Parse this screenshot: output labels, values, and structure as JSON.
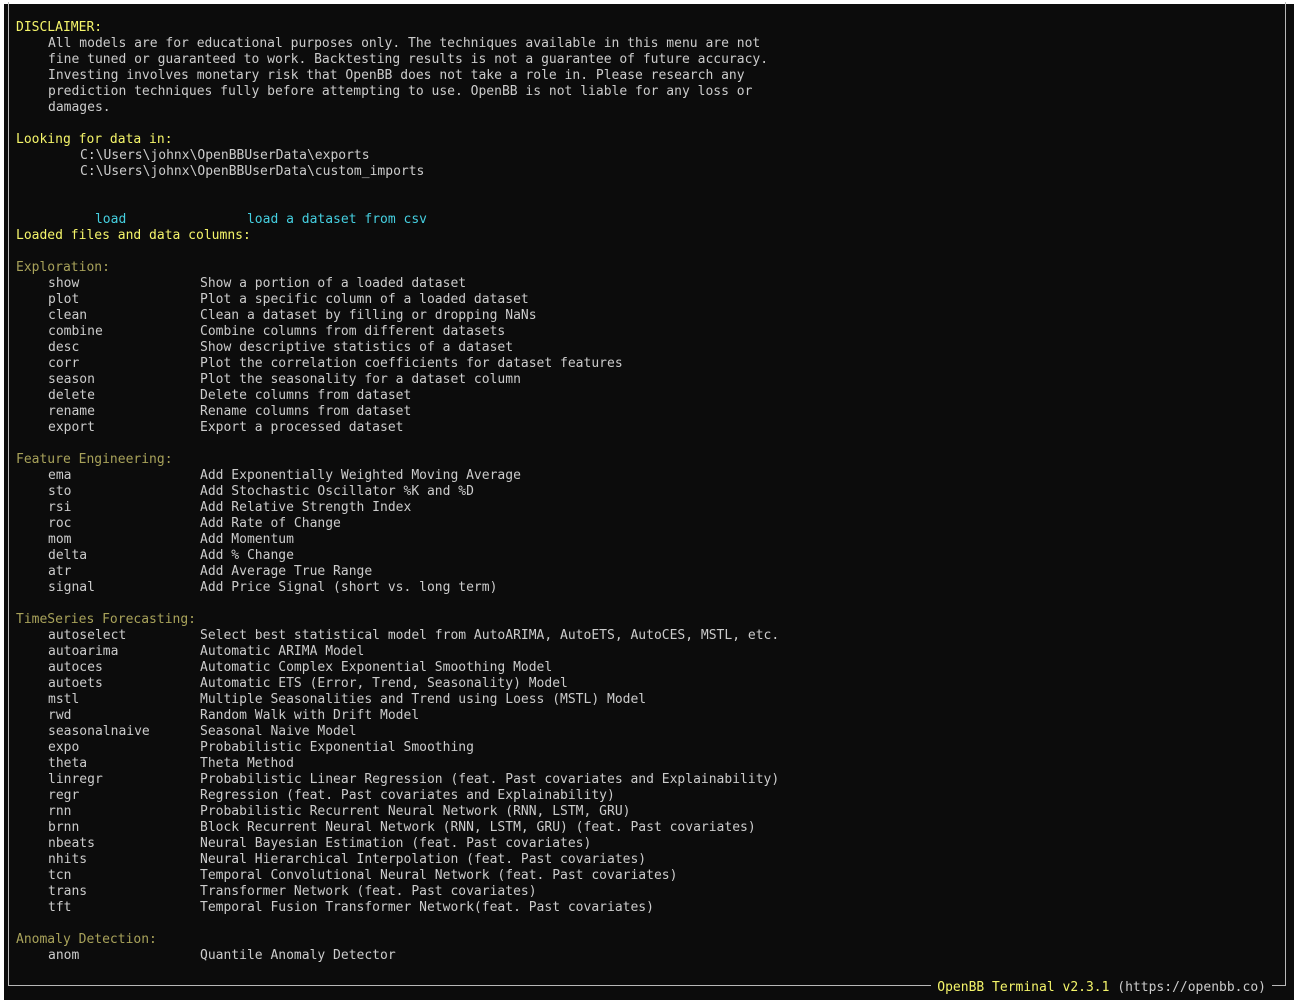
{
  "disclaimer": {
    "title": "DISCLAIMER:",
    "lines": [
      "All models are for educational purposes only. The techniques available in this menu are not",
      "fine tuned or guaranteed to work. Backtesting results is not a guarantee of future accuracy.",
      "Investing involves monetary risk that OpenBB does not take a role in. Please research any",
      "prediction techniques fully before attempting to use. OpenBB is not liable for any loss or",
      "damages."
    ]
  },
  "data_paths": {
    "title": "Looking for data in:",
    "paths": [
      "C:\\Users\\johnx\\OpenBBUserData\\exports",
      "C:\\Users\\johnx\\OpenBBUserData\\custom_imports"
    ]
  },
  "load": {
    "cmd": "load",
    "desc": "load a dataset from csv"
  },
  "loaded_title": "Loaded files and data columns:",
  "sections": [
    {
      "title": "Exploration:",
      "commands": [
        {
          "cmd": "show",
          "desc": "Show a portion of a loaded dataset"
        },
        {
          "cmd": "plot",
          "desc": "Plot a specific column of a loaded dataset"
        },
        {
          "cmd": "clean",
          "desc": "Clean a dataset by filling or dropping NaNs"
        },
        {
          "cmd": "combine",
          "desc": "Combine columns from different datasets"
        },
        {
          "cmd": "desc",
          "desc": "Show descriptive statistics of a dataset"
        },
        {
          "cmd": "corr",
          "desc": "Plot the correlation coefficients for dataset features"
        },
        {
          "cmd": "season",
          "desc": "Plot the seasonality for a dataset column"
        },
        {
          "cmd": "delete",
          "desc": "Delete columns from dataset"
        },
        {
          "cmd": "rename",
          "desc": "Rename columns from dataset"
        },
        {
          "cmd": "export",
          "desc": "Export a processed dataset"
        }
      ]
    },
    {
      "title": "Feature Engineering:",
      "commands": [
        {
          "cmd": "ema",
          "desc": "Add Exponentially Weighted Moving Average"
        },
        {
          "cmd": "sto",
          "desc": "Add Stochastic Oscillator %K and %D"
        },
        {
          "cmd": "rsi",
          "desc": "Add Relative Strength Index"
        },
        {
          "cmd": "roc",
          "desc": "Add Rate of Change"
        },
        {
          "cmd": "mom",
          "desc": "Add Momentum"
        },
        {
          "cmd": "delta",
          "desc": "Add % Change"
        },
        {
          "cmd": "atr",
          "desc": "Add Average True Range"
        },
        {
          "cmd": "signal",
          "desc": "Add Price Signal (short vs. long term)"
        }
      ]
    },
    {
      "title": "TimeSeries Forecasting:",
      "commands": [
        {
          "cmd": "autoselect",
          "desc": "Select best statistical model from AutoARIMA, AutoETS, AutoCES, MSTL, etc."
        },
        {
          "cmd": "autoarima",
          "desc": "Automatic ARIMA Model"
        },
        {
          "cmd": "autoces",
          "desc": "Automatic Complex Exponential Smoothing Model"
        },
        {
          "cmd": "autoets",
          "desc": "Automatic ETS (Error, Trend, Seasonality) Model"
        },
        {
          "cmd": "mstl",
          "desc": "Multiple Seasonalities and Trend using Loess (MSTL) Model"
        },
        {
          "cmd": "rwd",
          "desc": "Random Walk with Drift Model"
        },
        {
          "cmd": "seasonalnaive",
          "desc": "Seasonal Naive Model"
        },
        {
          "cmd": "expo",
          "desc": "Probabilistic Exponential Smoothing"
        },
        {
          "cmd": "theta",
          "desc": "Theta Method"
        },
        {
          "cmd": "linregr",
          "desc": "Probabilistic Linear Regression (feat. Past covariates and Explainability)"
        },
        {
          "cmd": "regr",
          "desc": "Regression (feat. Past covariates and Explainability)"
        },
        {
          "cmd": "rnn",
          "desc": "Probabilistic Recurrent Neural Network (RNN, LSTM, GRU)"
        },
        {
          "cmd": "brnn",
          "desc": "Block Recurrent Neural Network (RNN, LSTM, GRU) (feat. Past covariates)"
        },
        {
          "cmd": "nbeats",
          "desc": "Neural Bayesian Estimation (feat. Past covariates)"
        },
        {
          "cmd": "nhits",
          "desc": "Neural Hierarchical Interpolation (feat. Past covariates)"
        },
        {
          "cmd": "tcn",
          "desc": "Temporal Convolutional Neural Network (feat. Past covariates)"
        },
        {
          "cmd": "trans",
          "desc": "Transformer Network (feat. Past covariates)"
        },
        {
          "cmd": "tft",
          "desc": "Temporal Fusion Transformer Network(feat. Past covariates)"
        }
      ]
    },
    {
      "title": "Anomaly Detection:",
      "commands": [
        {
          "cmd": "anom",
          "desc": "Quantile Anomaly Detector"
        }
      ]
    }
  ],
  "footer": {
    "name": "OpenBB Terminal v2.3.1",
    "url": "(https://openbb.co)"
  },
  "colors": {
    "background": "#0c0c0c",
    "heading": "#f5f56a",
    "section": "#a8a25a",
    "command": "#45cfe0",
    "text": "#cccccc"
  }
}
